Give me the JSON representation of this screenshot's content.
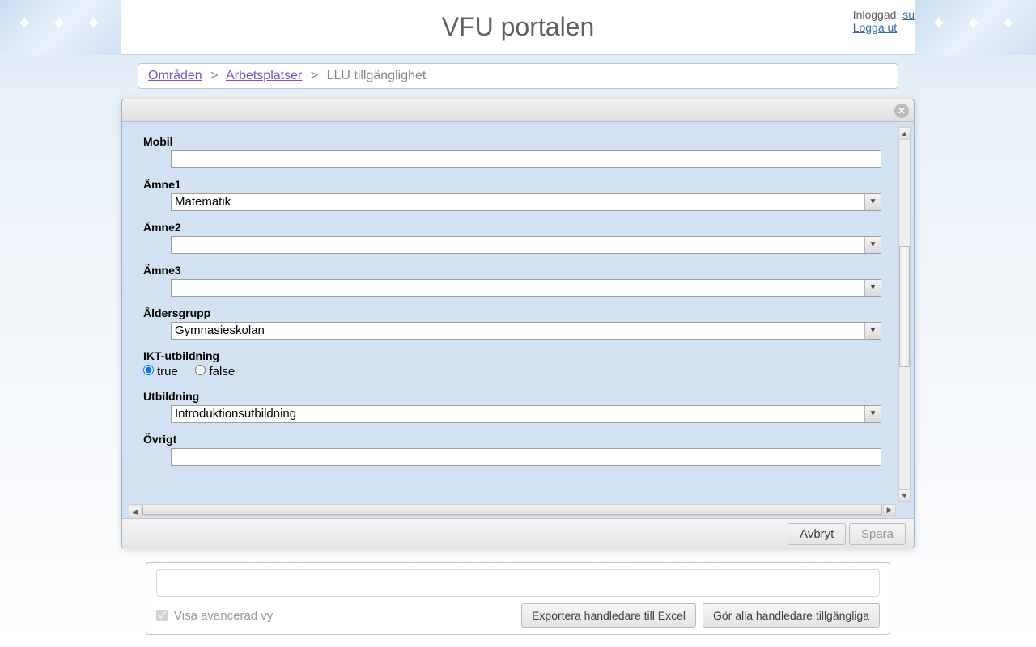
{
  "header": {
    "title": "VFU portalen",
    "logged_in_label": "Inloggad:",
    "user": "su",
    "logout": "Logga ut"
  },
  "breadcrumb": {
    "items": [
      "Områden",
      "Arbetsplatser"
    ],
    "sep": ">",
    "current": "LLU tillgänglighet"
  },
  "form": {
    "mobil": {
      "label": "Mobil",
      "value": ""
    },
    "amne1": {
      "label": "Ämne1",
      "value": "Matematik"
    },
    "amne2": {
      "label": "Ämne2",
      "value": ""
    },
    "amne3": {
      "label": "Ämne3",
      "value": ""
    },
    "aldersgrupp": {
      "label": "Åldersgrupp",
      "value": "Gymnasieskolan"
    },
    "ikt": {
      "label": "IKT-utbildning",
      "true_label": "true",
      "false_label": "false",
      "selected": "true"
    },
    "utbildning": {
      "label": "Utbildning",
      "value": "Introduktionsutbildning"
    },
    "ovrigt": {
      "label": "Övrigt",
      "value": ""
    }
  },
  "modal_footer": {
    "cancel": "Avbryt",
    "save": "Spara"
  },
  "bottom": {
    "advanced_label": "Visa avancerad vy",
    "export_btn": "Exportera handledare till Excel",
    "make_available_btn": "Gör alla handledare tillgängliga"
  }
}
